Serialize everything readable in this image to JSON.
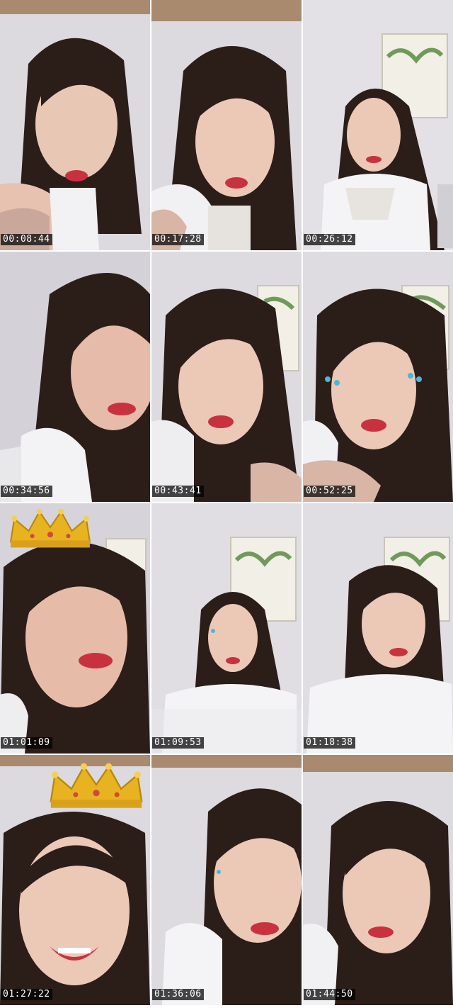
{
  "frames": [
    {
      "timestamp": "00:08:44"
    },
    {
      "timestamp": "00:17:28"
    },
    {
      "timestamp": "00:26:12"
    },
    {
      "timestamp": "00:34:56"
    },
    {
      "timestamp": "00:43:41"
    },
    {
      "timestamp": "00:52:25"
    },
    {
      "timestamp": "01:01:09"
    },
    {
      "timestamp": "01:09:53"
    },
    {
      "timestamp": "01:18:38"
    },
    {
      "timestamp": "01:27:22"
    },
    {
      "timestamp": "01:36:06"
    },
    {
      "timestamp": "01:44:50"
    }
  ],
  "colors": {
    "wall": "#e2e0e5",
    "hair": "#2b1d18",
    "skin": "#e8c2b0",
    "lips": "#c8323f",
    "shirt": "#f4f4f6",
    "crown": "#e8b320",
    "frame_art": "#f1efe6",
    "leaves": "#6f9a5a"
  },
  "icons": [
    "crown-filter-icon",
    "crown-filter-icon"
  ]
}
